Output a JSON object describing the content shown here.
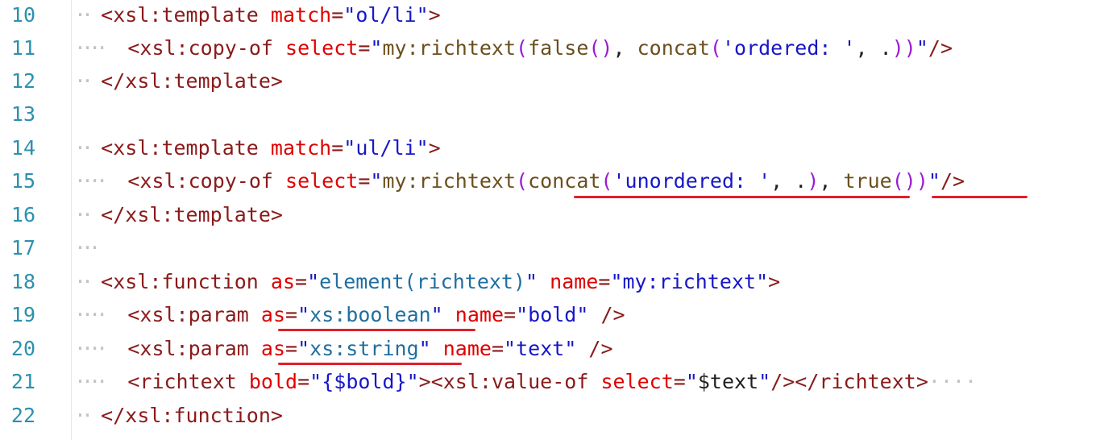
{
  "editor": {
    "lines": [
      {
        "num": "10",
        "indent": "··",
        "segments": [
          "<",
          "xsl:template",
          " ",
          "match",
          "=",
          "\"",
          "ol/li",
          "\"",
          ">"
        ]
      },
      {
        "num": "11",
        "indent": "····",
        "segments": [
          "<",
          "xsl:copy-of",
          " ",
          "select",
          "=",
          "\"",
          "my:richtext",
          "(",
          "false",
          "()",
          ", ",
          "concat",
          "(",
          "'ordered: '",
          ", .",
          ")",
          ")",
          "\"",
          "/>"
        ]
      },
      {
        "num": "12",
        "indent": "··",
        "segments": [
          "</",
          "xsl:template",
          ">"
        ]
      },
      {
        "num": "13",
        "indent": "",
        "segments": []
      },
      {
        "num": "14",
        "indent": "··",
        "segments": [
          "<",
          "xsl:template",
          " ",
          "match",
          "=",
          "\"",
          "ul/li",
          "\"",
          ">"
        ]
      },
      {
        "num": "15",
        "indent": "····",
        "segments": [
          "<",
          "xsl:copy-of",
          " ",
          "select",
          "=",
          "\"",
          "my:richtext",
          "(",
          "concat",
          "(",
          "'unordered: '",
          ", .",
          ")",
          ", ",
          "true",
          "()",
          ")",
          "\"",
          "/>"
        ]
      },
      {
        "num": "16",
        "indent": "··",
        "segments": [
          "</",
          "xsl:template",
          ">"
        ]
      },
      {
        "num": "17",
        "indent": "···",
        "segments": []
      },
      {
        "num": "18",
        "indent": "··",
        "segments": [
          "<",
          "xsl:function",
          " ",
          "as",
          "=",
          "\"",
          "element(richtext)",
          "\"",
          " ",
          "name",
          "=",
          "\"",
          "my:richtext",
          "\"",
          ">"
        ]
      },
      {
        "num": "19",
        "indent": "····",
        "segments": [
          "<",
          "xsl:param",
          " ",
          "as",
          "=",
          "\"",
          "xs:boolean",
          "\"",
          " ",
          "name",
          "=",
          "\"",
          "bold",
          "\"",
          " />"
        ]
      },
      {
        "num": "20",
        "indent": "····",
        "segments": [
          "<",
          "xsl:param",
          " ",
          "as",
          "=",
          "\"",
          "xs:string",
          "\"",
          " ",
          "name",
          "=",
          "\"",
          "text",
          "\"",
          " />"
        ]
      },
      {
        "num": "21",
        "indent": "····",
        "segments": [
          "<",
          "richtext",
          " ",
          "bold",
          "=",
          "\"",
          "{$bold}",
          "\"",
          "><",
          "xsl:value-of",
          " ",
          "select",
          "=",
          "\"",
          "$text",
          "\"",
          "/></",
          "richtext",
          ">",
          "····"
        ]
      },
      {
        "num": "22",
        "indent": "··",
        "segments": [
          "</",
          "xsl:function",
          ">"
        ]
      }
    ]
  },
  "highlight_color": "#e0202b"
}
